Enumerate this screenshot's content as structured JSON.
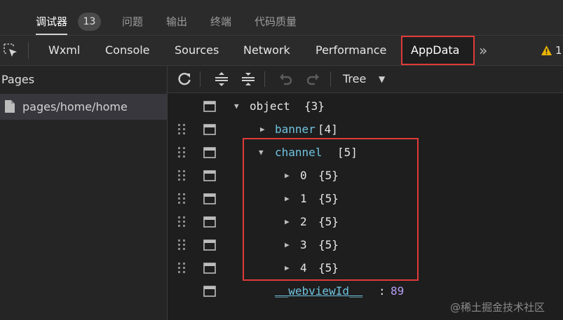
{
  "top_tabs": [
    {
      "label": "调试器",
      "active": true
    },
    {
      "label": "问题",
      "active": false
    },
    {
      "label": "输出",
      "active": false
    },
    {
      "label": "终端",
      "active": false
    },
    {
      "label": "代码质量",
      "active": false
    }
  ],
  "debugger_badge": "13",
  "panel_tabs": [
    "Wxml",
    "Console",
    "Sources",
    "Network",
    "Performance",
    "AppData"
  ],
  "panel_more": "»",
  "warning_count": "1",
  "sidebar": {
    "title": "Pages",
    "items": [
      "pages/home/home"
    ]
  },
  "toolbar": {
    "view_mode": "Tree"
  },
  "tree": {
    "root": {
      "key": "object",
      "meta": "{3}"
    },
    "banner": {
      "key": "banner",
      "meta": "[4]"
    },
    "channel": {
      "key": "channel",
      "meta": "[5]"
    },
    "channel_items": [
      {
        "key": "0",
        "meta": "{5}"
      },
      {
        "key": "1",
        "meta": "{5}"
      },
      {
        "key": "2",
        "meta": "{5}"
      },
      {
        "key": "3",
        "meta": "{5}"
      },
      {
        "key": "4",
        "meta": "{5}"
      }
    ],
    "webview": {
      "key": "__webviewId__",
      "sep": ":",
      "value": "89"
    }
  },
  "watermark": "@稀土掘金技术社区",
  "colors": {
    "highlight_border": "#e03a3a",
    "key_blue": "#6fc3df",
    "number_purple": "#b5a0f5"
  }
}
